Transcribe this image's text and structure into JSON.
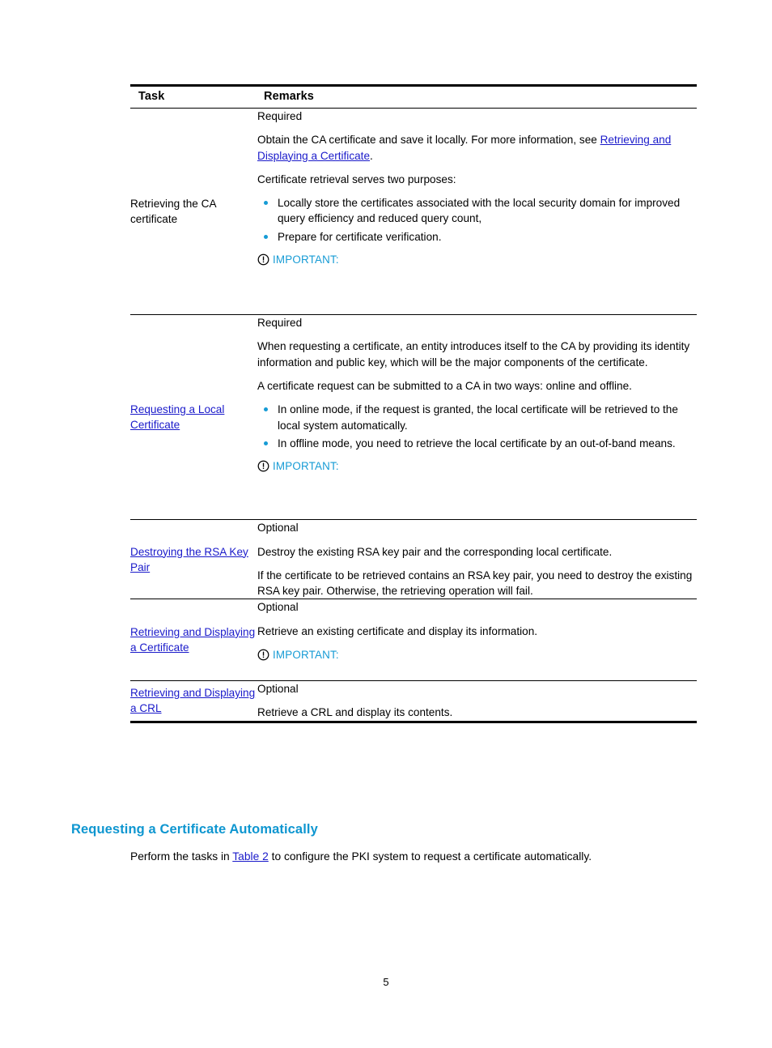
{
  "table": {
    "headers": {
      "task": "Task",
      "remarks": "Remarks"
    },
    "rows": [
      {
        "task_label": "Retrieving the CA certificate",
        "task_is_link": false,
        "requirement": "Required",
        "para1_prefix": "Obtain the CA certificate and save it locally. For more information, see ",
        "para1_link": "Retrieving and Displaying a Certificate",
        "para1_suffix": ".",
        "para2": "Certificate retrieval serves two purposes:",
        "bullets": [
          "Locally store the certificates associated with the local security domain for improved query efficiency and reduced query count,",
          "Prepare for certificate verification."
        ],
        "important_label": "IMPORTANT:"
      },
      {
        "task_label": "Requesting a Local Certificate",
        "task_is_link": true,
        "requirement": "Required",
        "para1": "When requesting a certificate, an entity introduces itself to the CA by providing its identity information and public key, which will be the major components of the certificate.",
        "para2": "A certificate request can be submitted to a CA in two ways: online and offline.",
        "bullets": [
          "In online mode, if the request is granted, the local certificate will be retrieved to the local system automatically.",
          "In offline mode, you need to retrieve the local certificate by an out-of-band means."
        ],
        "important_label": "IMPORTANT:"
      },
      {
        "task_label": "Destroying the RSA Key Pair",
        "task_is_link": true,
        "requirement": "Optional",
        "para1": "Destroy the existing RSA key pair and the corresponding local certificate.",
        "para2": "If the certificate to be retrieved contains an RSA key pair, you need to destroy the existing RSA key pair. Otherwise, the retrieving operation will fail."
      },
      {
        "task_label": "Retrieving and Displaying a Certificate",
        "task_is_link": true,
        "requirement": "Optional",
        "para1": "Retrieve an existing certificate and display its information.",
        "important_label": "IMPORTANT:"
      },
      {
        "task_label": "Retrieving and Displaying a CRL",
        "task_is_link": true,
        "requirement": "Optional",
        "para1": "Retrieve a CRL and display its contents."
      }
    ]
  },
  "section": {
    "heading": "Requesting a Certificate Automatically",
    "body_prefix": "Perform the tasks in ",
    "body_link": "Table 2",
    "body_suffix": " to configure the PKI system to request a certificate automatically."
  },
  "footer": {
    "page_number": "5"
  },
  "colors": {
    "accent": "#169bd5",
    "heading": "#0e96d0",
    "link": "#1a1aca",
    "rule": "#000000"
  }
}
